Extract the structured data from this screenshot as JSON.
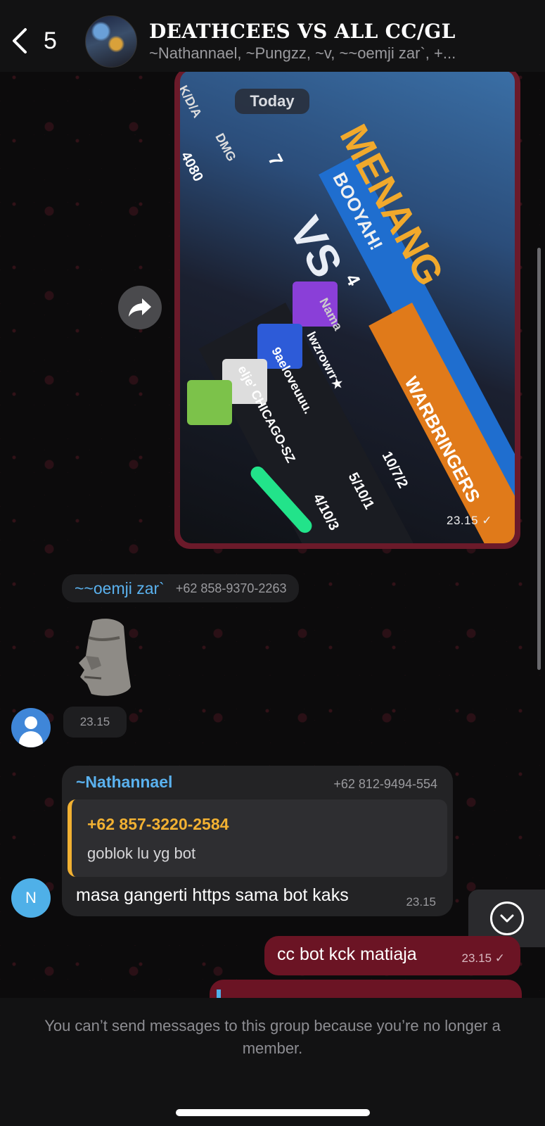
{
  "header": {
    "back_count": "5",
    "title": "DEATHCEES VS ALL CC/GL",
    "members": "~Nathannael, ~Pungzz, ~v, ~~oemji zar`, +..."
  },
  "date_separator": "Today",
  "image_message": {
    "time": "23.15 ✓",
    "game_text": {
      "menang": "MENANG",
      "booyah": "BOOYAH!",
      "vs": "VS",
      "team": "WARBRINGERS",
      "nama": "Nama",
      "kda": "K/D/A",
      "dmg": "DMG",
      "dmg_value": "4080",
      "score_left": "7",
      "score_right": "4",
      "player_1": "lwzrowrr★",
      "player_2": "9aeloveuuu.",
      "player_3": "elje' CHICAGO-SZ",
      "kda_1": "10/7/2",
      "kda_2": "5/10/1",
      "kda_3": "4/10/3"
    }
  },
  "sticker_message": {
    "sender": "~~oemji zar`",
    "phone": "+62 858-9370-2263",
    "time": "23.15"
  },
  "reply_message": {
    "sender": "~Nathannael",
    "phone": "+62 812-9494-554",
    "quote_sender": "+62 857-3220-2584",
    "quote_text": "goblok lu yg bot",
    "text": "masa gangerti https sama bot kaks",
    "time": "23.15",
    "avatar_initial": "N"
  },
  "outgoing_message": {
    "text": "cc bot kck matiaja",
    "time": "23.15 ✓"
  },
  "footer": {
    "notice": "You can’t send messages to this group because you’re no longer a member."
  },
  "colors": {
    "accent_blue": "#5ab1ee",
    "quote_yellow": "#f2b132",
    "outgoing_bubble": "#6b1424"
  }
}
